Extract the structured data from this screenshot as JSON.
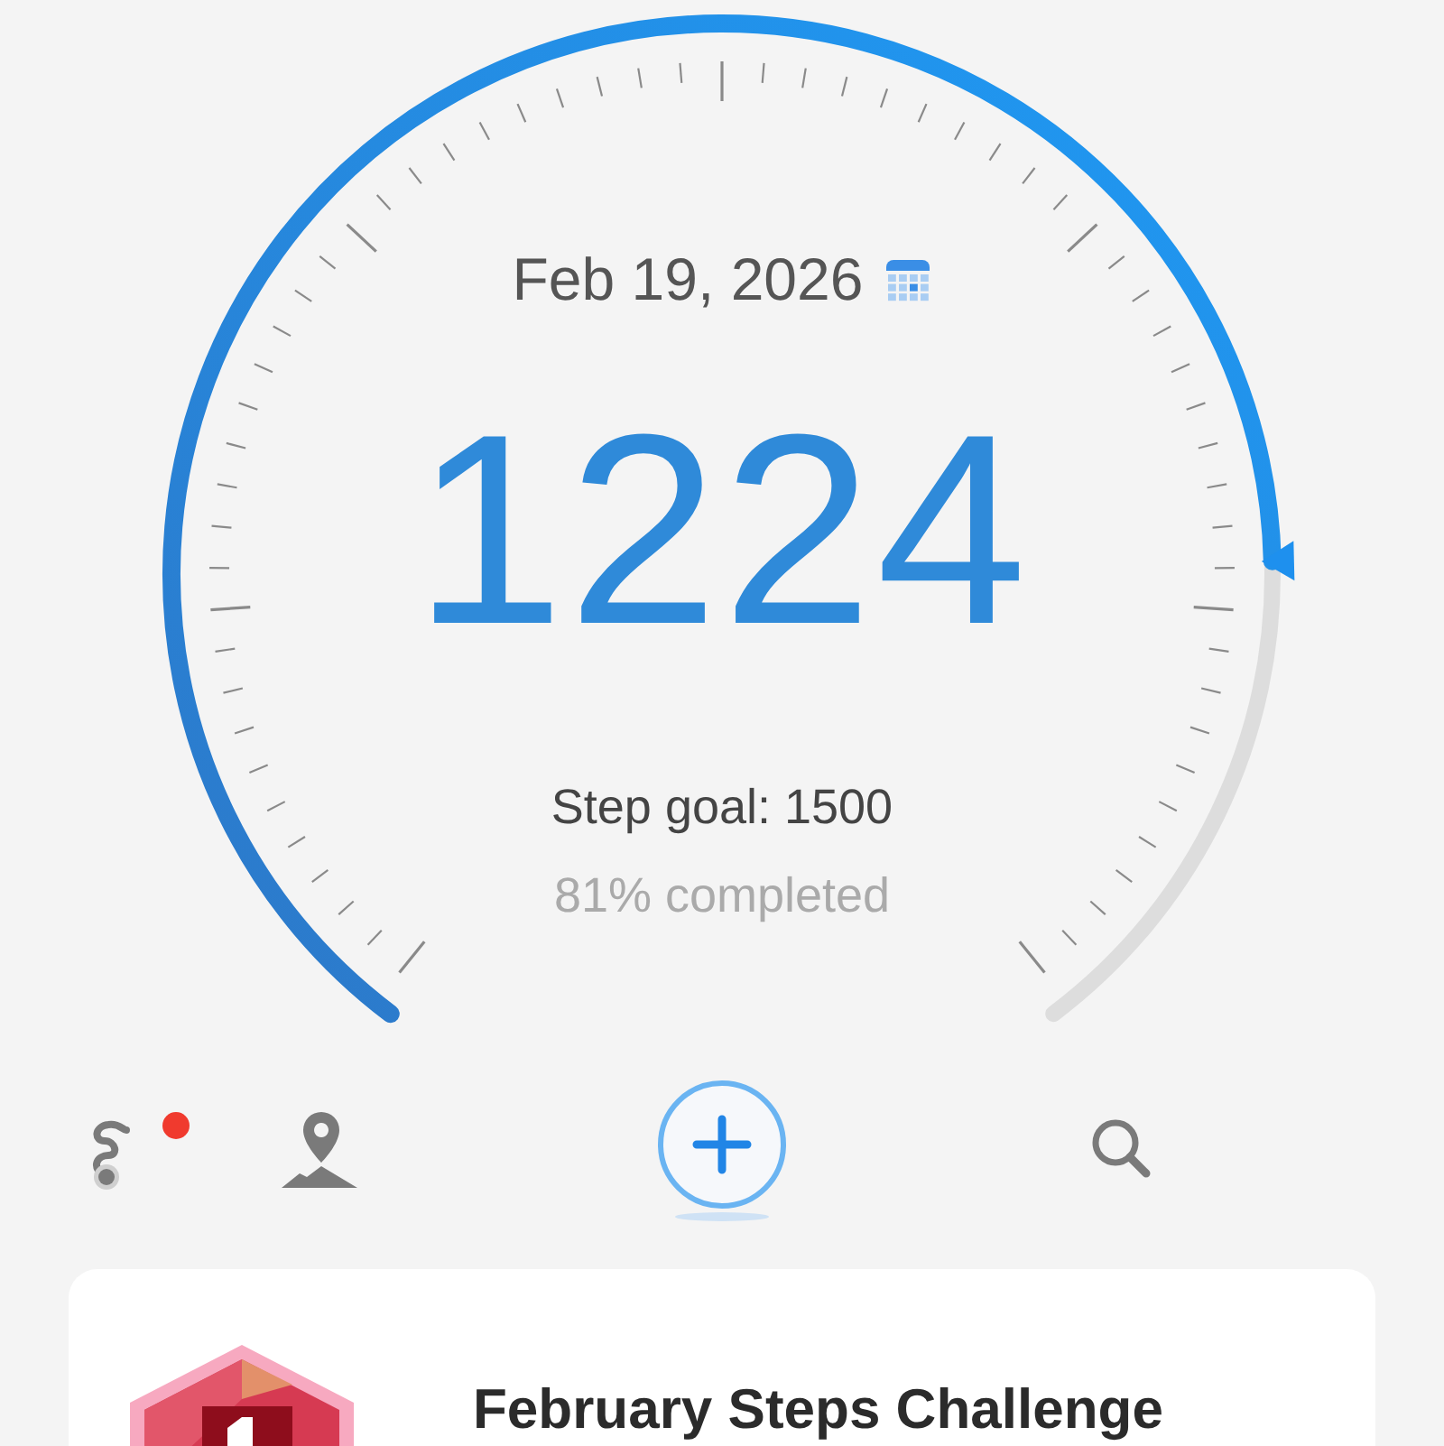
{
  "date": "Feb 19, 2026",
  "steps": "1224",
  "goal_label": "Step goal: 1500",
  "percent_label": "81% completed",
  "toolbar": [
    {
      "kind": "route",
      "notification": true
    },
    {
      "kind": "map",
      "notification": false
    },
    {
      "kind": "add",
      "notification": false
    },
    {
      "kind": "search",
      "notification": false
    }
  ],
  "challenge": {
    "title": "February Steps Challenge"
  }
}
